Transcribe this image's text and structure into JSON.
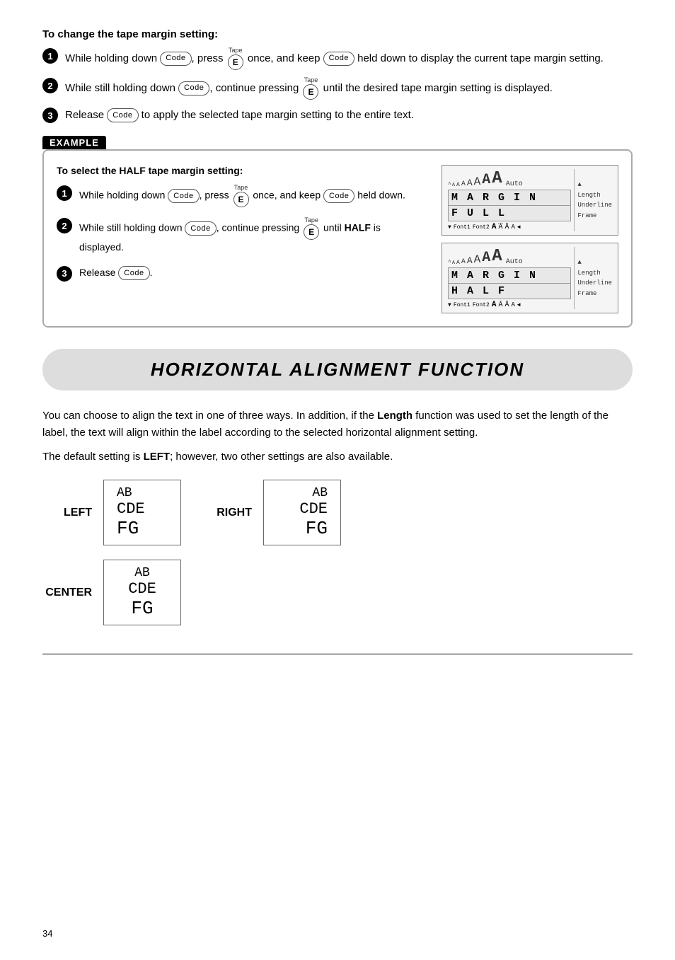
{
  "tape_margin": {
    "section_title": "To change the tape margin setting:",
    "steps": [
      {
        "num": "1",
        "parts": [
          "While holding down ",
          "Code",
          " , press ",
          "E",
          " once, and keep ",
          "Code",
          " held down to display the current tape margin setting."
        ]
      },
      {
        "num": "2",
        "parts": [
          "While still holding down ",
          "Code",
          " , continue pressing ",
          "E",
          " until the desired tape margin setting is displayed."
        ]
      },
      {
        "num": "3",
        "parts": [
          "Release ",
          "Code",
          " to apply the selected tape margin setting to the entire text."
        ]
      }
    ]
  },
  "example": {
    "label": "EXAMPLE",
    "subtitle": "To select the HALF tape margin setting:",
    "steps": [
      {
        "num": "1",
        "text": "While holding down  Code , press  E  once, and keep  Code  held down."
      },
      {
        "num": "2",
        "text": "While still holding down  Code , continue pressing  E  until HALF is displayed."
      },
      {
        "num": "3",
        "text": "Release  Code ."
      }
    ],
    "display1": {
      "top": "^ A A A A A A A",
      "row1": "M A R G I N",
      "row2": "F U L L",
      "bottom": "Font1 Font2  A  Ā  Å  A  ◄",
      "auto": "Auto",
      "sidebar": [
        "▲",
        "Length",
        "Underline",
        "Frame",
        "▼"
      ]
    },
    "display2": {
      "top": "^ A A A A A A A",
      "row1": "M A R G I N",
      "row2": "H A L F",
      "bottom": "Font1 Font2  A  Ā  Å  A  ◄",
      "auto": "Auto",
      "sidebar": [
        "▲",
        "Length",
        "Underline",
        "Frame",
        "▼"
      ]
    }
  },
  "halign": {
    "title": "HORIZONTAL ALIGNMENT FUNCTION",
    "desc1": "You can choose to align the text in one of three ways. In addition, if the Length function was used to set the length of the label, the text will align within the label according to the selected horizontal alignment setting.",
    "desc2": "The default setting is LEFT; however, two other settings are also available.",
    "items": [
      {
        "label": "LEFT",
        "align": "left",
        "lines": [
          "AB",
          "CDE",
          "FG"
        ]
      },
      {
        "label": "RIGHT",
        "align": "right",
        "lines": [
          "AB",
          "CDE",
          "FG"
        ]
      },
      {
        "label": "CENTER",
        "align": "center",
        "lines": [
          "AB",
          "CDE",
          "FG"
        ]
      }
    ]
  },
  "footer": {
    "page_num": "34"
  }
}
